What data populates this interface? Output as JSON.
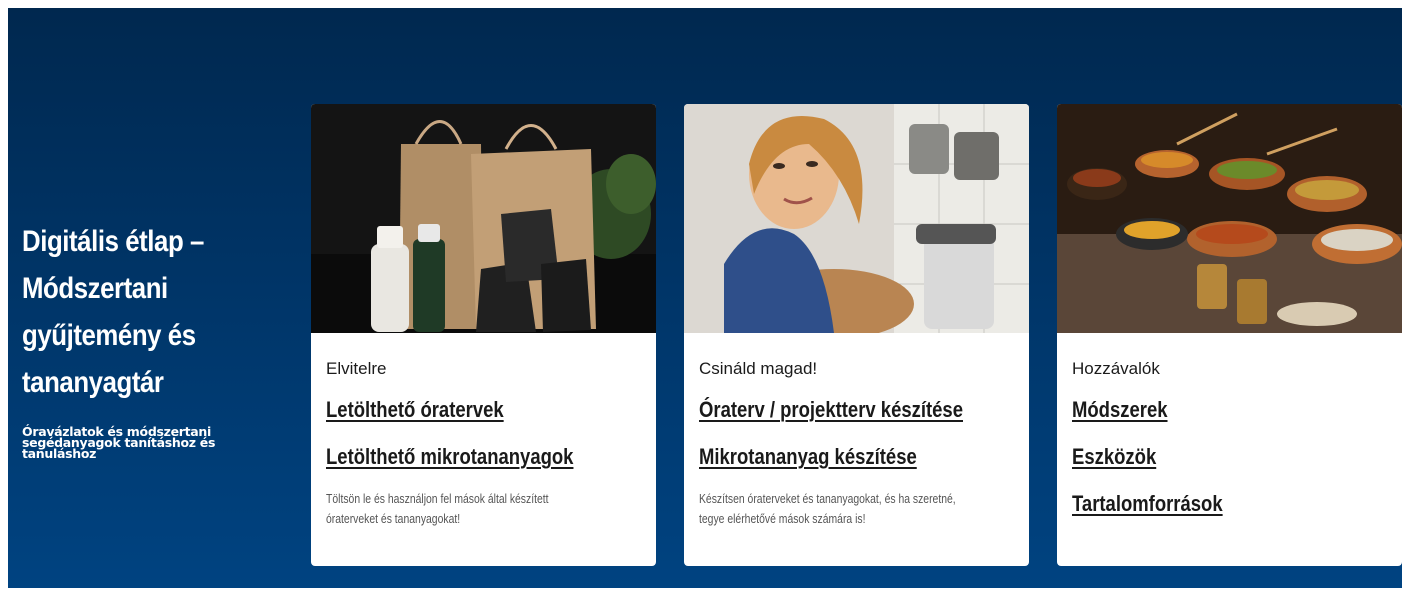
{
  "hero": {
    "title": "Digitális étlap – Módszertani gyűjtemény és tananyagtár",
    "subtitle": "Óravázlatok és módszertani segédanyagok tanításhoz és tanuláshoz"
  },
  "cards": [
    {
      "photo": "takeaway-bags-photo",
      "category": "Elvitelre",
      "links": [
        "Letölthető óratervek",
        "Letölthető mikrotananyagok"
      ],
      "description": "Töltsön le és használjon fel mások által készített óraterveket és tananyagokat!"
    },
    {
      "photo": "woman-in-kitchen-photo",
      "category": "Csináld magad!",
      "links": [
        "Óraterv / projektterv készítése",
        "Mikrotananyag készítése"
      ],
      "description": "Készítsen óraterveket és tananyagokat, és ha szeretné, tegye elérhetővé mások számára is!"
    },
    {
      "photo": "spice-bowls-photo",
      "category": "Hozzávalók",
      "links": [
        "Módszerek",
        "Eszközök",
        "Tartalomforrások"
      ],
      "description": ""
    }
  ],
  "colors": {
    "hero_top": "#00284f",
    "hero_bottom": "#004381",
    "card_bg": "#ffffff",
    "link_text": "#1a1a1a"
  }
}
